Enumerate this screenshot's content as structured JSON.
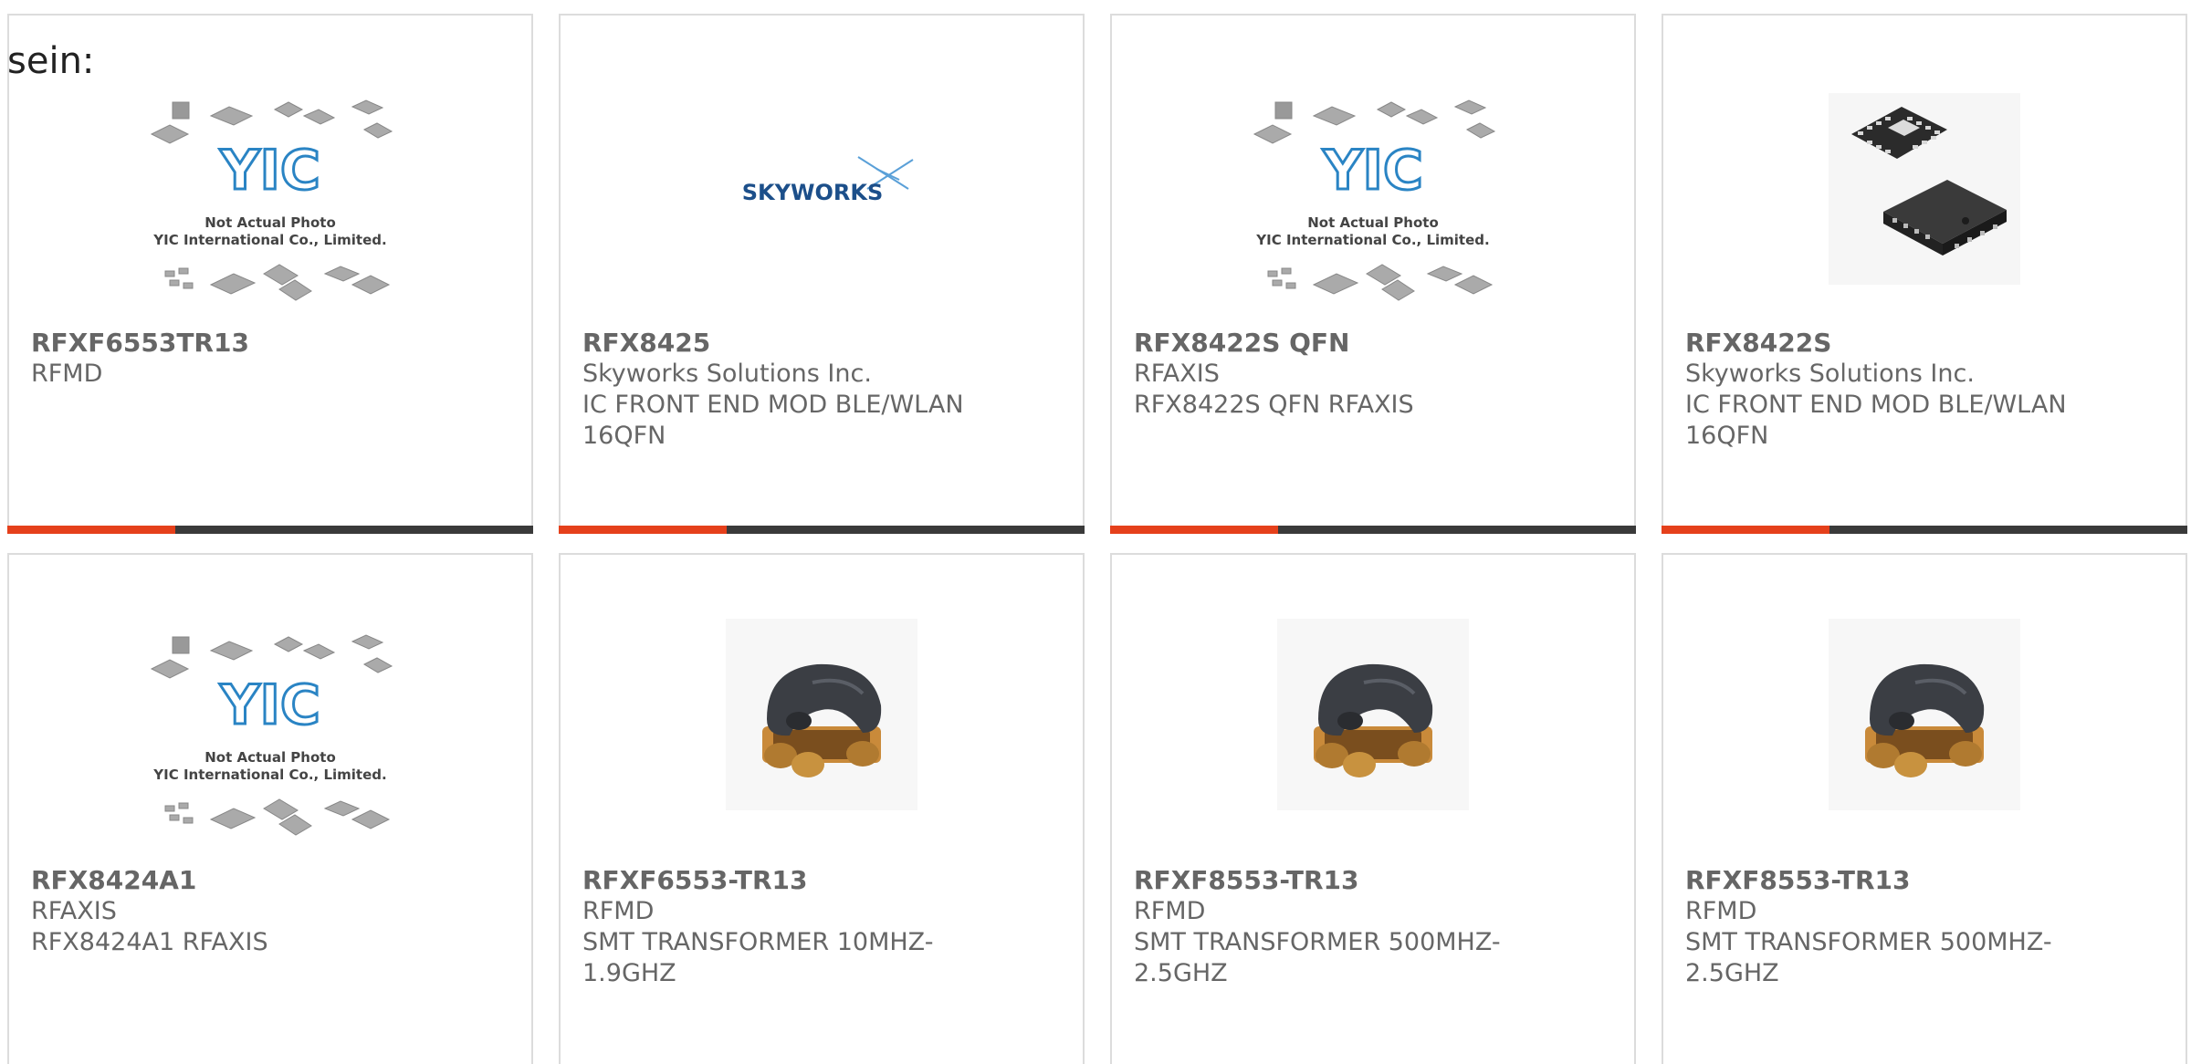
{
  "lead_text": "sein:",
  "colors": {
    "accent": "#e5401b",
    "bar": "#3a3a3a",
    "border": "#dcdcdc",
    "text": "#666666"
  },
  "placeholder": {
    "line1": "Not Actual Photo",
    "line2": "YIC International Co., Limited.",
    "logo": "YIC"
  },
  "skyworks_logo": "SKYWORKS",
  "products": [
    {
      "part": "RFXF6553TR13",
      "maker": "RFMD",
      "desc1": "",
      "desc2": "",
      "image": "yic-placeholder"
    },
    {
      "part": "RFX8425",
      "maker": "Skyworks Solutions Inc.",
      "desc1": "IC FRONT END MOD BLE/WLAN",
      "desc2": "16QFN",
      "image": "skyworks-logo"
    },
    {
      "part": "RFX8422S QFN",
      "maker": "RFAXIS",
      "desc1": "RFX8422S QFN RFAXIS",
      "desc2": "",
      "image": "yic-placeholder"
    },
    {
      "part": "RFX8422S",
      "maker": "Skyworks Solutions Inc.",
      "desc1": "IC FRONT END MOD BLE/WLAN",
      "desc2": "16QFN",
      "image": "qfn-chip"
    },
    {
      "part": "RFX8424A1",
      "maker": "RFAXIS",
      "desc1": "RFX8424A1 RFAXIS",
      "desc2": "",
      "image": "yic-placeholder"
    },
    {
      "part": "RFXF6553-TR13",
      "maker": "RFMD",
      "desc1": "SMT TRANSFORMER 10MHZ-",
      "desc2": "1.9GHZ",
      "image": "smt-transformer"
    },
    {
      "part": "RFXF8553-TR13",
      "maker": "RFMD",
      "desc1": "SMT TRANSFORMER 500MHZ-",
      "desc2": "2.5GHZ",
      "image": "smt-transformer"
    },
    {
      "part": "RFXF8553-TR13",
      "maker": "RFMD",
      "desc1": "SMT TRANSFORMER 500MHZ-",
      "desc2": "2.5GHZ",
      "image": "smt-transformer"
    }
  ]
}
